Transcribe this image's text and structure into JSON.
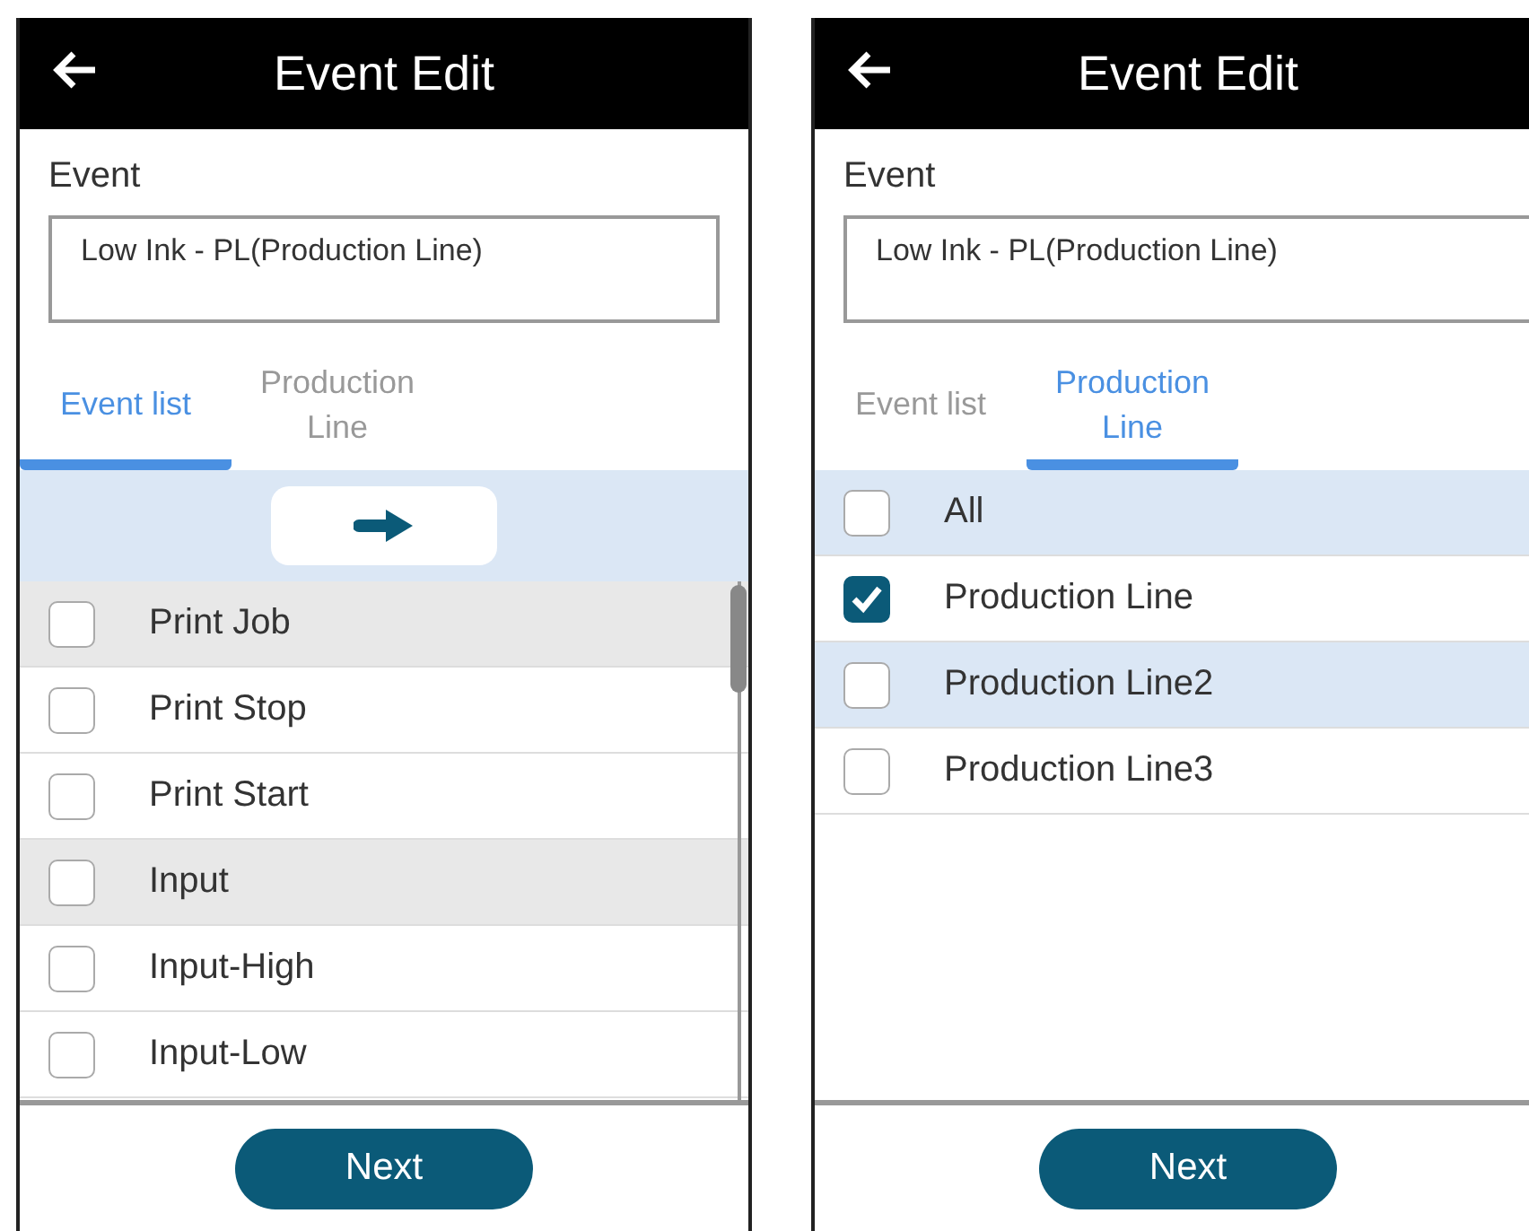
{
  "screens": [
    {
      "title": "Event Edit",
      "event_label": "Event",
      "event_value": "Low Ink - PL(Production Line)",
      "tabs": [
        {
          "label": "Event list",
          "selected": true
        },
        {
          "label": "Production Line",
          "selected": false
        }
      ],
      "arrow_bar": true,
      "scrollbar": true,
      "items": [
        {
          "label": "Print Job",
          "checked": false,
          "kind": "group"
        },
        {
          "label": "Print Stop",
          "checked": false,
          "kind": "item"
        },
        {
          "label": "Print Start",
          "checked": false,
          "kind": "item"
        },
        {
          "label": "Input",
          "checked": false,
          "kind": "group"
        },
        {
          "label": "Input-High",
          "checked": false,
          "kind": "item"
        },
        {
          "label": "Input-Low",
          "checked": false,
          "kind": "item"
        }
      ],
      "next": "Next"
    },
    {
      "title": "Event Edit",
      "event_label": "Event",
      "event_value": "Low Ink - PL(Production Line)",
      "tabs": [
        {
          "label": "Event list",
          "selected": false
        },
        {
          "label": "Production Line",
          "selected": true
        }
      ],
      "items": [
        {
          "label": "All",
          "checked": false,
          "kind": "stripe"
        },
        {
          "label": "Production Line",
          "checked": true,
          "kind": "item"
        },
        {
          "label": "Production Line2",
          "checked": false,
          "kind": "stripe"
        },
        {
          "label": "Production Line3",
          "checked": false,
          "kind": "item"
        }
      ],
      "next": "Next"
    }
  ]
}
